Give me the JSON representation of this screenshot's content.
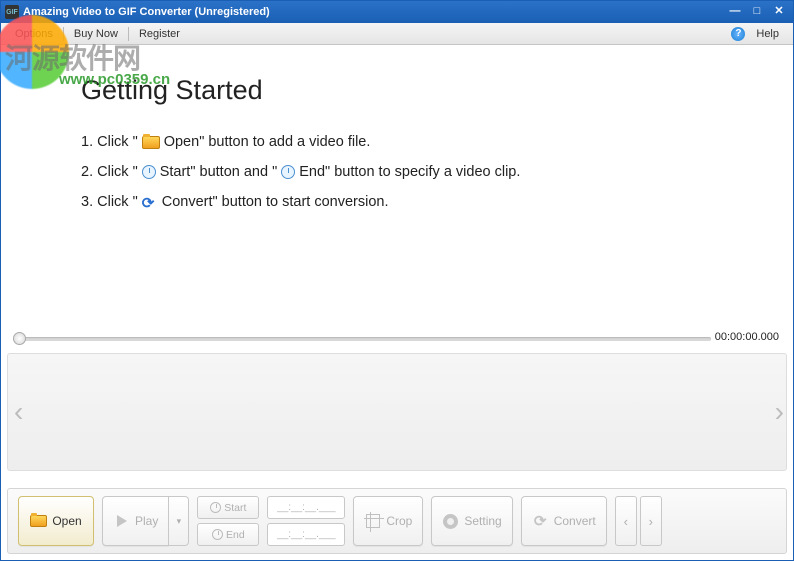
{
  "titlebar": {
    "app_icon_text": "GIF",
    "title": "Amazing Video to GIF Converter (Unregistered)"
  },
  "menubar": {
    "options": "Options",
    "buy": "Buy Now",
    "register": "Register",
    "help": "Help"
  },
  "watermark": {
    "chars": "河源软件网",
    "url": "www.pc0359.cn"
  },
  "content": {
    "heading": "Getting Started",
    "step1_a": "1. Click \"",
    "step1_b": " Open\" button to add a video file.",
    "step2_a": "2. Click \"",
    "step2_b": " Start\" button and \"",
    "step2_c": " End\" button to specify a video clip.",
    "step3_a": "3. Click \"",
    "step3_b": " Convert\" button to start conversion."
  },
  "timeline": {
    "time": "00:00:00.000"
  },
  "toolbar": {
    "open": "Open",
    "play": "Play",
    "start": "Start",
    "end": "End",
    "start_val": "__:__:__.___",
    "end_val": "__:__:__.___",
    "crop": "Crop",
    "setting": "Setting",
    "convert": "Convert"
  }
}
